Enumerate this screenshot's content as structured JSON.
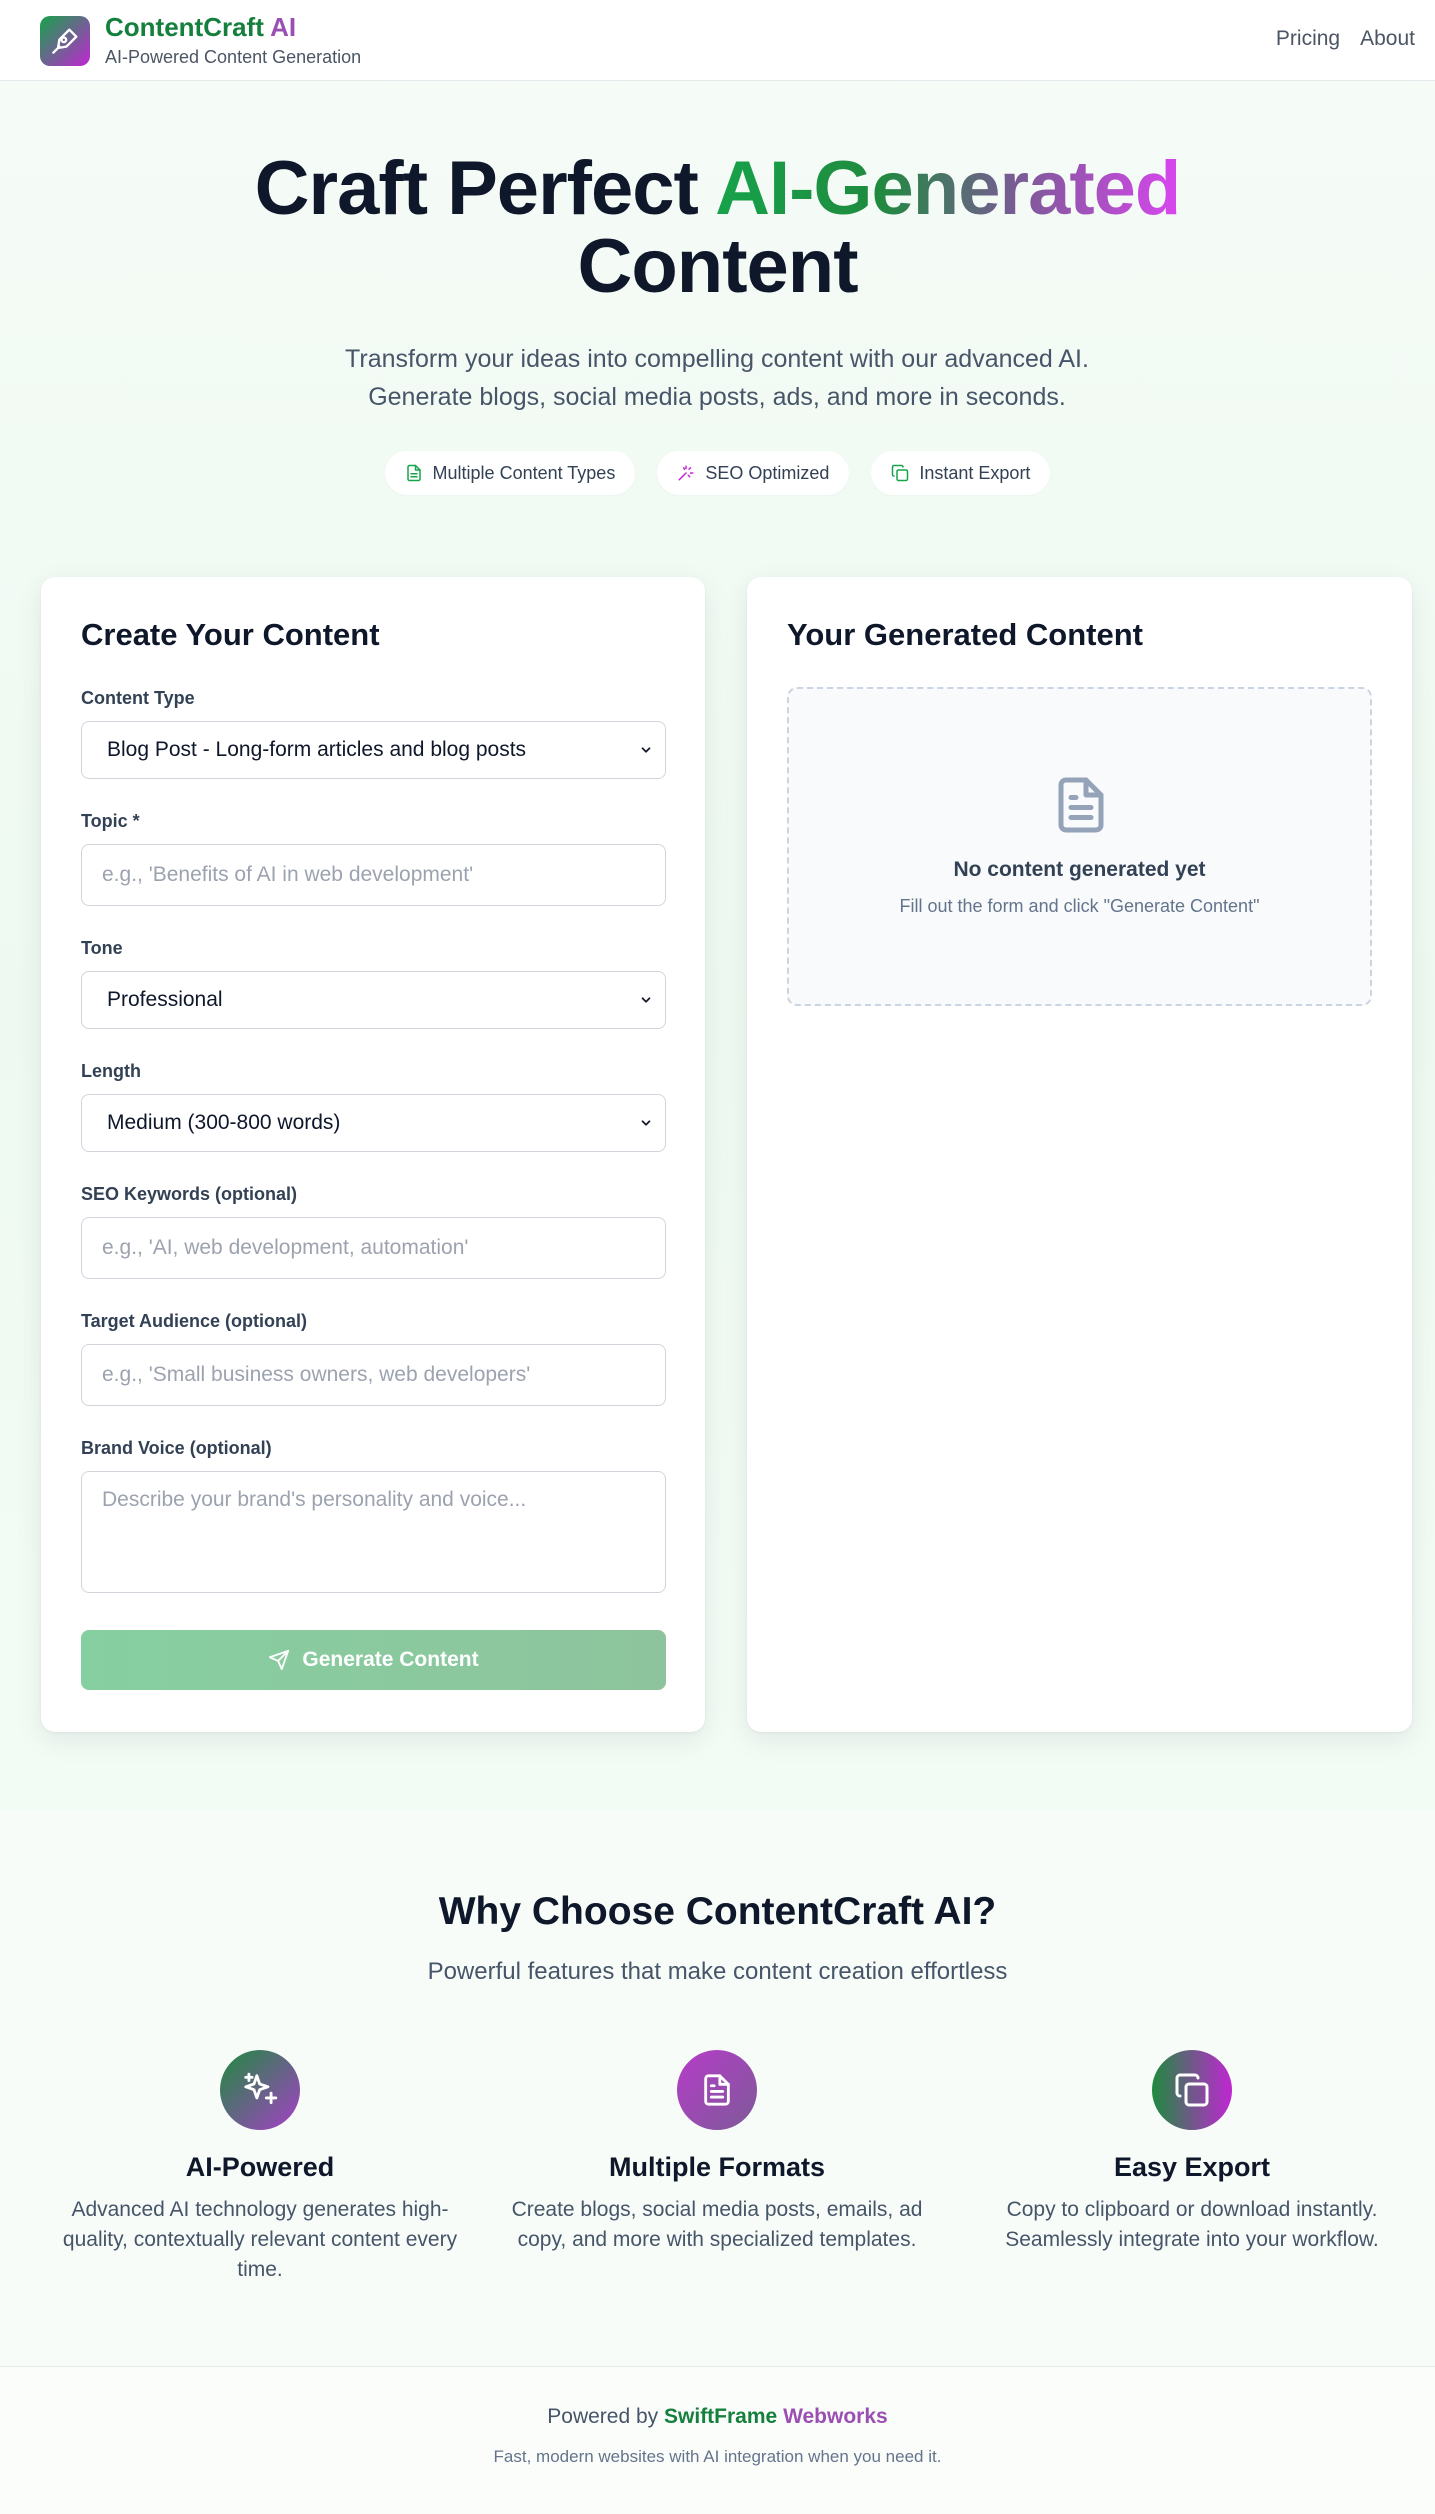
{
  "header": {
    "brand_part1": "ContentCraft",
    "brand_part2": "AI",
    "tagline": "AI-Powered Content Generation",
    "nav": [
      "Pricing",
      "About"
    ]
  },
  "hero": {
    "title_line1_plain": "Craft Perfect ",
    "title_line1_gradient": "AI-Generated",
    "title_line2": "Content",
    "subtitle_line1": "Transform your ideas into compelling content with our advanced AI.",
    "subtitle_line2": "Generate blogs, social media posts, ads, and more in seconds.",
    "pills": [
      {
        "label": "Multiple Content Types",
        "icon": "document-icon"
      },
      {
        "label": "SEO Optimized",
        "icon": "sparkles-icon"
      },
      {
        "label": "Instant Export",
        "icon": "copy-icon"
      }
    ]
  },
  "form": {
    "title": "Create Your Content",
    "content_type": {
      "label": "Content Type",
      "value": "Blog Post - Long-form articles and blog posts"
    },
    "topic": {
      "label": "Topic *",
      "placeholder": "e.g., 'Benefits of AI in web development'"
    },
    "tone": {
      "label": "Tone",
      "value": "Professional"
    },
    "length": {
      "label": "Length",
      "value": "Medium (300-800 words)"
    },
    "seo": {
      "label": "SEO Keywords (optional)",
      "placeholder": "e.g., 'AI, web development, automation'"
    },
    "audience": {
      "label": "Target Audience (optional)",
      "placeholder": "e.g., 'Small business owners, web developers'"
    },
    "brand_voice": {
      "label": "Brand Voice (optional)",
      "placeholder": "Describe your brand's personality and voice..."
    },
    "submit_label": "Generate Content"
  },
  "output": {
    "title": "Your Generated Content",
    "empty_title": "No content generated yet",
    "empty_sub": "Fill out the form and click \"Generate Content\""
  },
  "features": {
    "title": "Why Choose ContentCraft AI?",
    "subtitle": "Powerful features that make content creation effortless",
    "items": [
      {
        "title": "AI-Powered",
        "desc": "Advanced AI technology generates high-quality, contextually relevant content every time.",
        "icon": "sparkles-icon"
      },
      {
        "title": "Multiple Formats",
        "desc": "Create blogs, social media posts, emails, ad copy, and more with specialized templates.",
        "icon": "document-icon"
      },
      {
        "title": "Easy Export",
        "desc": "Copy to clipboard or download instantly. Seamlessly integrate into your workflow.",
        "icon": "copy-icon"
      }
    ]
  },
  "footer": {
    "powered_by": "Powered by ",
    "company_part1": "SwiftFrame",
    "company_part2": "Webworks",
    "tagline": "Fast, modern websites with AI integration when you need it."
  },
  "colors": {
    "brand_green": "#16a34a",
    "brand_purple": "#c026d3",
    "button_disabled": "#8ec9a0"
  }
}
